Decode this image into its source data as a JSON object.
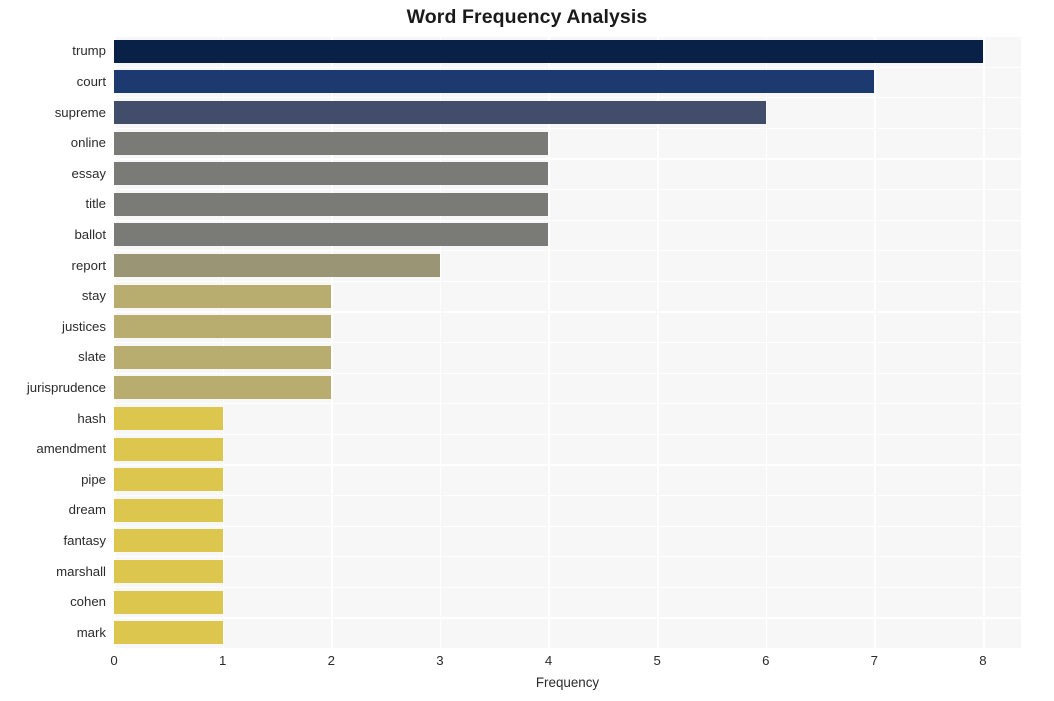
{
  "chart_data": {
    "type": "bar",
    "orientation": "horizontal",
    "title": "Word Frequency Analysis",
    "xlabel": "Frequency",
    "ylabel": "",
    "xlim": [
      0,
      8.35
    ],
    "ylim": [
      0,
      20
    ],
    "grid": true,
    "legend": false,
    "xticks": [
      "0",
      "1",
      "2",
      "3",
      "4",
      "5",
      "6",
      "7",
      "8"
    ],
    "xtick_values": [
      0,
      1,
      2,
      3,
      4,
      5,
      6,
      7,
      8
    ],
    "categories": [
      "trump",
      "court",
      "supreme",
      "online",
      "essay",
      "title",
      "ballot",
      "report",
      "stay",
      "justices",
      "slate",
      "jurisprudence",
      "hash",
      "amendment",
      "pipe",
      "dream",
      "fantasy",
      "marshall",
      "cohen",
      "mark"
    ],
    "values": [
      8,
      7,
      6,
      4,
      4,
      4,
      4,
      3,
      2,
      2,
      2,
      2,
      1,
      1,
      1,
      1,
      1,
      1,
      1,
      1
    ],
    "bar_colors": [
      "#0a2147",
      "#1d3a70",
      "#424d6b",
      "#7a7a77",
      "#7a7a77",
      "#7a7a77",
      "#7a7a77",
      "#9a9575",
      "#b8ac6e",
      "#b8ac6e",
      "#b8ac6e",
      "#b8ac6e",
      "#dcc64e",
      "#dcc64e",
      "#dcc64e",
      "#dcc64e",
      "#dcc64e",
      "#dcc64e",
      "#dcc64e",
      "#dcc64e"
    ]
  },
  "style": {
    "figure_background": "#ffffff",
    "plot_background": "#f7f7f7",
    "grid_color": "#ffffff",
    "text_color": "#2b2b2b",
    "title_color": "#1a1a1a"
  }
}
